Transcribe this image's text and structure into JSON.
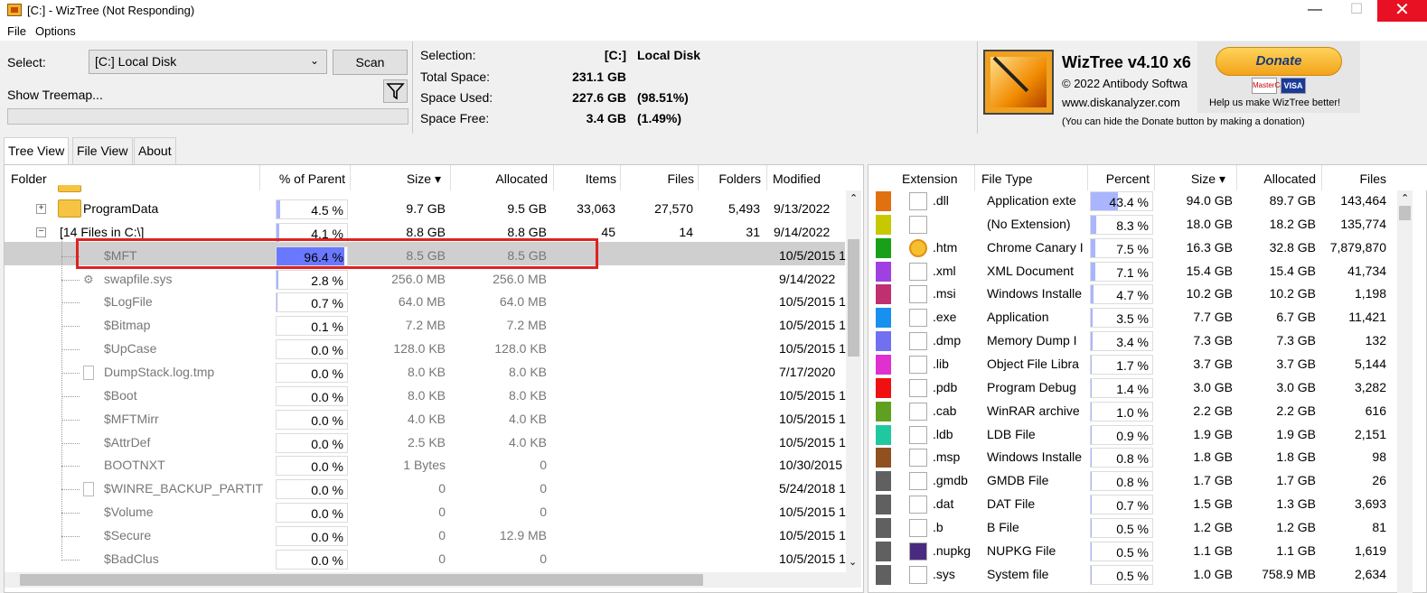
{
  "window": {
    "title": "[C:]  - WizTree (Not Responding)",
    "minimize": "—",
    "maximize": "☐",
    "close": "✕"
  },
  "menu": {
    "file": "File",
    "options": "Options"
  },
  "toolbar": {
    "select_label": "Select:",
    "drive": "[C:] Local Disk",
    "scan_label": "Scan",
    "show_treemap": "Show Treemap...",
    "filter_icon": "filter-icon"
  },
  "stats": {
    "selection_label": "Selection:",
    "selection_drive": "[C:]",
    "selection_name": "Local Disk",
    "total_label": "Total Space:",
    "total_value": "231.1 GB",
    "used_label": "Space Used:",
    "used_value": "227.6 GB",
    "used_pct": "(98.51%)",
    "free_label": "Space Free:",
    "free_value": "3.4 GB",
    "free_pct": "(1.49%)"
  },
  "about": {
    "app_name": "WizTree v4.10 x6",
    "copyright": "© 2022 Antibody Softwa",
    "website": "www.diskanalyzer.com",
    "donate_note": "(You can hide the Donate button by making a donation)",
    "donate_label": "Donate",
    "donate_help": "Help us make WizTree better!",
    "mastercard": "MasterCard",
    "visa": "VISA"
  },
  "tabs": [
    "Tree View",
    "File View",
    "About"
  ],
  "tree": {
    "columns": [
      "Folder",
      "% of Parent",
      "Size ▾",
      "Allocated",
      "Items",
      "Files",
      "Folders",
      "Modified"
    ],
    "rows": [
      {
        "name": "ProgramData",
        "pct": "4.5 %",
        "pct_value": 4.5,
        "size": "9.7 GB",
        "allocated": "9.5 GB",
        "items": "33,063",
        "files": "27,570",
        "folders": "5,493",
        "modified": "9/13/2022"
      },
      {
        "name": "[14 Files in C:\\]",
        "pct": "4.1 %",
        "pct_value": 4.1,
        "size": "8.8 GB",
        "allocated": "8.8 GB",
        "items": "45",
        "files": "14",
        "folders": "31",
        "modified": "9/14/2022"
      },
      {
        "name": "$MFT",
        "pct": "96.4 %",
        "pct_value": 96.4,
        "size": "8.5 GB",
        "allocated": "8.5 GB",
        "items": "",
        "files": "",
        "folders": "",
        "modified": "10/5/2015 1"
      },
      {
        "name": "swapfile.sys",
        "pct": "2.8 %",
        "pct_value": 2.8,
        "size": "256.0 MB",
        "allocated": "256.0 MB",
        "items": "",
        "files": "",
        "folders": "",
        "modified": "9/14/2022"
      },
      {
        "name": "$LogFile",
        "pct": "0.7 %",
        "pct_value": 0.7,
        "size": "64.0 MB",
        "allocated": "64.0 MB",
        "items": "",
        "files": "",
        "folders": "",
        "modified": "10/5/2015 1"
      },
      {
        "name": "$Bitmap",
        "pct": "0.1 %",
        "pct_value": 0.1,
        "size": "7.2 MB",
        "allocated": "7.2 MB",
        "items": "",
        "files": "",
        "folders": "",
        "modified": "10/5/2015 1"
      },
      {
        "name": "$UpCase",
        "pct": "0.0 %",
        "pct_value": 0,
        "size": "128.0 KB",
        "allocated": "128.0 KB",
        "items": "",
        "files": "",
        "folders": "",
        "modified": "10/5/2015 1"
      },
      {
        "name": "DumpStack.log.tmp",
        "pct": "0.0 %",
        "pct_value": 0,
        "size": "8.0 KB",
        "allocated": "8.0 KB",
        "items": "",
        "files": "",
        "folders": "",
        "modified": "7/17/2020"
      },
      {
        "name": "$Boot",
        "pct": "0.0 %",
        "pct_value": 0,
        "size": "8.0 KB",
        "allocated": "8.0 KB",
        "items": "",
        "files": "",
        "folders": "",
        "modified": "10/5/2015 1"
      },
      {
        "name": "$MFTMirr",
        "pct": "0.0 %",
        "pct_value": 0,
        "size": "4.0 KB",
        "allocated": "4.0 KB",
        "items": "",
        "files": "",
        "folders": "",
        "modified": "10/5/2015 1"
      },
      {
        "name": "$AttrDef",
        "pct": "0.0 %",
        "pct_value": 0,
        "size": "2.5 KB",
        "allocated": "4.0 KB",
        "items": "",
        "files": "",
        "folders": "",
        "modified": "10/5/2015 1"
      },
      {
        "name": "BOOTNXT",
        "pct": "0.0 %",
        "pct_value": 0,
        "size": "1 Bytes",
        "allocated": "0",
        "items": "",
        "files": "",
        "folders": "",
        "modified": "10/30/2015"
      },
      {
        "name": "$WINRE_BACKUP_PARTIT",
        "pct": "0.0 %",
        "pct_value": 0,
        "size": "0",
        "allocated": "0",
        "items": "",
        "files": "",
        "folders": "",
        "modified": "5/24/2018 1"
      },
      {
        "name": "$Volume",
        "pct": "0.0 %",
        "pct_value": 0,
        "size": "0",
        "allocated": "0",
        "items": "",
        "files": "",
        "folders": "",
        "modified": "10/5/2015 1"
      },
      {
        "name": "$Secure",
        "pct": "0.0 %",
        "pct_value": 0,
        "size": "0",
        "allocated": "12.9 MB",
        "items": "",
        "files": "",
        "folders": "",
        "modified": "10/5/2015 1"
      },
      {
        "name": "$BadClus",
        "pct": "0.0 %",
        "pct_value": 0,
        "size": "0",
        "allocated": "0",
        "items": "",
        "files": "",
        "folders": "",
        "modified": "10/5/2015 1"
      }
    ]
  },
  "extensions": {
    "columns": [
      "Extension",
      "File Type",
      "Percent",
      "Size ▾",
      "Allocated",
      "Files"
    ],
    "rows": [
      {
        "color": "#e07010",
        "ext": ".dll",
        "type": "Application exte",
        "pct": "43.4 %",
        "pct_value": 43.4,
        "size": "94.0 GB",
        "allocated": "89.7 GB",
        "files": "143,464"
      },
      {
        "color": "#c8c800",
        "ext": "",
        "type": "(No Extension)",
        "pct": "8.3 %",
        "pct_value": 8.3,
        "size": "18.0 GB",
        "allocated": "18.2 GB",
        "files": "135,774"
      },
      {
        "color": "#18a018",
        "ext": ".htm",
        "type": "Chrome Canary I",
        "pct": "7.5 %",
        "pct_value": 7.5,
        "size": "16.3 GB",
        "allocated": "32.8 GB",
        "files": "7,879,870"
      },
      {
        "color": "#a040e0",
        "ext": ".xml",
        "type": "XML Document",
        "pct": "7.1 %",
        "pct_value": 7.1,
        "size": "15.4 GB",
        "allocated": "15.4 GB",
        "files": "41,734"
      },
      {
        "color": "#c03070",
        "ext": ".msi",
        "type": "Windows Installe",
        "pct": "4.7 %",
        "pct_value": 4.7,
        "size": "10.2 GB",
        "allocated": "10.2 GB",
        "files": "1,198"
      },
      {
        "color": "#1890f0",
        "ext": ".exe",
        "type": "Application",
        "pct": "3.5 %",
        "pct_value": 3.5,
        "size": "7.7 GB",
        "allocated": "6.7 GB",
        "files": "11,421"
      },
      {
        "color": "#7070f0",
        "ext": ".dmp",
        "type": "Memory Dump I",
        "pct": "3.4 %",
        "pct_value": 3.4,
        "size": "7.3 GB",
        "allocated": "7.3 GB",
        "files": "132"
      },
      {
        "color": "#e030d0",
        "ext": ".lib",
        "type": "Object File Libra",
        "pct": "1.7 %",
        "pct_value": 1.7,
        "size": "3.7 GB",
        "allocated": "3.7 GB",
        "files": "5,144"
      },
      {
        "color": "#f01010",
        "ext": ".pdb",
        "type": "Program Debug",
        "pct": "1.4 %",
        "pct_value": 1.4,
        "size": "3.0 GB",
        "allocated": "3.0 GB",
        "files": "3,282"
      },
      {
        "color": "#60a020",
        "ext": ".cab",
        "type": "WinRAR archive",
        "pct": "1.0 %",
        "pct_value": 1.0,
        "size": "2.2 GB",
        "allocated": "2.2 GB",
        "files": "616"
      },
      {
        "color": "#20c8a0",
        "ext": ".ldb",
        "type": "LDB File",
        "pct": "0.9 %",
        "pct_value": 0.9,
        "size": "1.9 GB",
        "allocated": "1.9 GB",
        "files": "2,151"
      },
      {
        "color": "#905020",
        "ext": ".msp",
        "type": "Windows Installe",
        "pct": "0.8 %",
        "pct_value": 0.8,
        "size": "1.8 GB",
        "allocated": "1.8 GB",
        "files": "98"
      },
      {
        "color": "#606060",
        "ext": ".gmdb",
        "type": "GMDB File",
        "pct": "0.8 %",
        "pct_value": 0.8,
        "size": "1.7 GB",
        "allocated": "1.7 GB",
        "files": "26"
      },
      {
        "color": "#606060",
        "ext": ".dat",
        "type": "DAT File",
        "pct": "0.7 %",
        "pct_value": 0.7,
        "size": "1.5 GB",
        "allocated": "1.3 GB",
        "files": "3,693"
      },
      {
        "color": "#606060",
        "ext": ".b",
        "type": "B File",
        "pct": "0.5 %",
        "pct_value": 0.5,
        "size": "1.2 GB",
        "allocated": "1.2 GB",
        "files": "81"
      },
      {
        "color": "#606060",
        "ext": ".nupkg",
        "type": "NUPKG File",
        "pct": "0.5 %",
        "pct_value": 0.5,
        "size": "1.1 GB",
        "allocated": "1.1 GB",
        "files": "1,619"
      },
      {
        "color": "#606060",
        "ext": ".sys",
        "type": "System file",
        "pct": "0.5 %",
        "pct_value": 0.5,
        "size": "1.0 GB",
        "allocated": "758.9 MB",
        "files": "2,634"
      }
    ]
  }
}
